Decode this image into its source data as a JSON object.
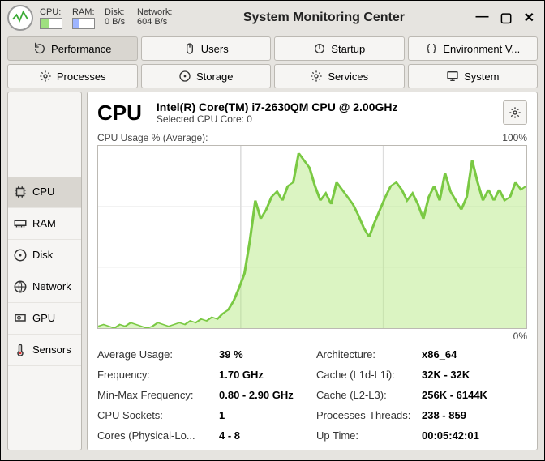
{
  "window": {
    "title": "System Monitoring Center"
  },
  "sysbar": {
    "cpu": {
      "label": "CPU:"
    },
    "ram": {
      "label": "RAM:"
    },
    "disk": {
      "label": "Disk:",
      "value": "0 B/s"
    },
    "net": {
      "label": "Network:",
      "value": "604 B/s"
    }
  },
  "tabs": {
    "performance": "Performance",
    "users": "Users",
    "startup": "Startup",
    "env": "Environment V...",
    "processes": "Processes",
    "storage": "Storage",
    "services": "Services",
    "system": "System"
  },
  "sidebar": {
    "cpu": "CPU",
    "ram": "RAM",
    "disk": "Disk",
    "network": "Network",
    "gpu": "GPU",
    "sensors": "Sensors"
  },
  "header": {
    "title": "CPU",
    "model": "Intel(R) Core(TM) i7-2630QM CPU @ 2.00GHz",
    "selected": "Selected CPU Core: 0"
  },
  "chart": {
    "label": "CPU Usage % (Average):",
    "max": "100%",
    "min": "0%"
  },
  "chart_data": {
    "type": "line",
    "title": "CPU Usage % (Average)",
    "xlabel": "",
    "ylabel": "Usage %",
    "ylim": [
      0,
      100
    ],
    "x": [
      0,
      1,
      2,
      3,
      4,
      5,
      6,
      7,
      8,
      9,
      10,
      11,
      12,
      13,
      14,
      15,
      16,
      17,
      18,
      19,
      20,
      21,
      22,
      23,
      24,
      25,
      26,
      27,
      28,
      29,
      30,
      31,
      32,
      33,
      34,
      35,
      36,
      37,
      38,
      39,
      40,
      41,
      42,
      43,
      44,
      45,
      46,
      47,
      48,
      49,
      50,
      51,
      52,
      53,
      54,
      55,
      56,
      57,
      58,
      59,
      60,
      61,
      62,
      63,
      64,
      65,
      66,
      67,
      68,
      69,
      70,
      71,
      72,
      73,
      74,
      75,
      76,
      77,
      78,
      79
    ],
    "values": [
      1,
      2,
      1,
      0,
      2,
      1,
      3,
      2,
      1,
      0,
      1,
      3,
      2,
      1,
      2,
      3,
      2,
      4,
      3,
      5,
      4,
      6,
      5,
      8,
      10,
      15,
      22,
      30,
      48,
      70,
      60,
      65,
      72,
      75,
      70,
      78,
      80,
      96,
      92,
      88,
      78,
      70,
      74,
      68,
      80,
      76,
      72,
      68,
      62,
      55,
      50,
      58,
      65,
      72,
      78,
      80,
      76,
      70,
      74,
      68,
      60,
      72,
      78,
      70,
      85,
      75,
      70,
      65,
      72,
      92,
      80,
      70,
      76,
      70,
      76,
      70,
      72,
      80,
      76,
      78
    ]
  },
  "stats": {
    "avg_l": "Average Usage:",
    "avg_v": "39 %",
    "freq_l": "Frequency:",
    "freq_v": "1.70 GHz",
    "mmfreq_l": "Min-Max Frequency:",
    "mmfreq_v": "0.80 - 2.90 GHz",
    "sock_l": "CPU Sockets:",
    "sock_v": "1",
    "cores_l": "Cores (Physical-Lo...",
    "cores_v": "4 - 8",
    "arch_l": "Architecture:",
    "arch_v": "x86_64",
    "cache1_l": "Cache (L1d-L1i):",
    "cache1_v": "32K - 32K",
    "cache2_l": "Cache (L2-L3):",
    "cache2_v": "256K - 6144K",
    "pt_l": "Processes-Threads:",
    "pt_v": "238 - 859",
    "up_l": "Up Time:",
    "up_v": "00:05:42:01"
  }
}
